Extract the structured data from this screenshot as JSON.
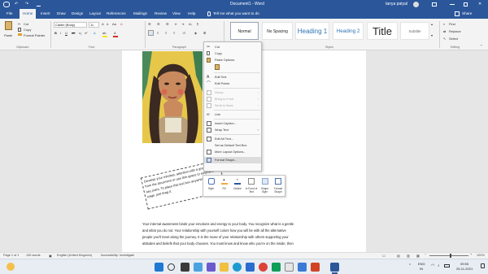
{
  "window": {
    "title": "Document1 - Word",
    "user": "tanya patyal",
    "qat": {
      "undo": "↶",
      "redo": "↷",
      "save": "💾",
      "autosave": "▢"
    }
  },
  "tabs": [
    "File",
    "Home",
    "Insert",
    "Draw",
    "Design",
    "Layout",
    "References",
    "Mailings",
    "Review",
    "View",
    "Help"
  ],
  "tell_me": "Tell me what you want to do",
  "share": "Share",
  "clipboard": {
    "paste": "Paste",
    "cut": "Cut",
    "copy": "Copy",
    "format_painter": "Format Painter",
    "group": "Clipboard"
  },
  "font": {
    "name": "Calibri (Body)",
    "size": "11",
    "group": "Font"
  },
  "paragraph": {
    "group": "Paragraph"
  },
  "styles": {
    "items": [
      "Normal",
      "No Spacing",
      "Heading 1",
      "Heading 2",
      "Title",
      "Subtitle"
    ],
    "group": "Styles"
  },
  "editing": {
    "find": "Find",
    "replace": "Replace",
    "select": "Select",
    "group": "Editing"
  },
  "context_menu": {
    "items": [
      {
        "label": "Cut",
        "icon": "scissors-icon",
        "disabled": false
      },
      {
        "label": "Copy",
        "icon": "copy-icon",
        "disabled": false
      },
      {
        "label": "Paste Options:",
        "icon": "paste-icon",
        "disabled": false
      },
      {
        "label": "",
        "icon": "paste-option-icon",
        "disabled": false
      },
      {
        "label": "Edit Text",
        "icon": "edit-text-icon",
        "disabled": false
      },
      {
        "label": "Edit Points",
        "icon": "edit-points-icon",
        "disabled": false
      },
      {
        "label": "Group",
        "icon": "group-icon",
        "disabled": true,
        "arrow": true
      },
      {
        "label": "Bring to Front",
        "icon": "bring-front-icon",
        "disabled": true,
        "arrow": true
      },
      {
        "label": "Send to Back",
        "icon": "send-back-icon",
        "disabled": true,
        "arrow": true
      },
      {
        "label": "Link",
        "icon": "link-icon",
        "disabled": false
      },
      {
        "label": "Insert Caption...",
        "icon": "caption-icon",
        "disabled": false
      },
      {
        "label": "Wrap Text",
        "icon": "wrap-text-icon",
        "disabled": false,
        "arrow": true
      },
      {
        "label": "Edit Alt Text...",
        "icon": "alt-text-icon",
        "disabled": false
      },
      {
        "label": "Set as Default Text Box",
        "icon": "",
        "disabled": false
      },
      {
        "label": "More Layout Options...",
        "icon": "layout-options-icon",
        "disabled": false
      },
      {
        "label": "Format Shape...",
        "icon": "format-shape-icon",
        "disabled": false,
        "highlight": true
      }
    ]
  },
  "mini_toolbar": {
    "items": [
      {
        "label": "Style",
        "icon": "style-icon"
      },
      {
        "label": "Fill",
        "icon": "fill-icon"
      },
      {
        "label": "Outline",
        "icon": "outline-icon"
      },
      {
        "label": "In Front of Text",
        "icon": "in-front-icon"
      },
      {
        "label": "Shape Style",
        "icon": "shape-style-icon"
      },
      {
        "label": "Format Shape",
        "icon": "format-shape-icon"
      }
    ]
  },
  "textbox": {
    "text": "Develop your mindset, attention with a great quote from the document or use this space to emphasize a key point. To place this text box anywhere on the page, just drag it."
  },
  "body": {
    "lines": [
      "Your internal awareness binds your emotions and energy to your body. You recognize what is a gentle",
      "and what you do not. Your relationship with yourself colors how you will be with all the alternative",
      "people you'll meet along the journey. It is the muse of your relationship with others supporting your",
      "attitudes and beliefs that your body chooses. You must know and know who you're on the inside, then"
    ]
  },
  "status": {
    "page": "Page 1 of 1",
    "words": "130 words",
    "language": "English (United Kingdom)",
    "accessibility": "Accessibility: Investigate",
    "zoom": "120%"
  },
  "taskbar": {
    "lang": "ENG",
    "region": "IN",
    "time": "09:55",
    "date": "25-11-2021"
  },
  "colors": {
    "word_blue": "#2b579a",
    "ribbon_bg": "#f3f3f3",
    "doc_bg": "#e6e6e6",
    "photo_yellow": "#e6c74a",
    "highlight_yellow": "#f5e31a",
    "font_red": "#d93025"
  }
}
